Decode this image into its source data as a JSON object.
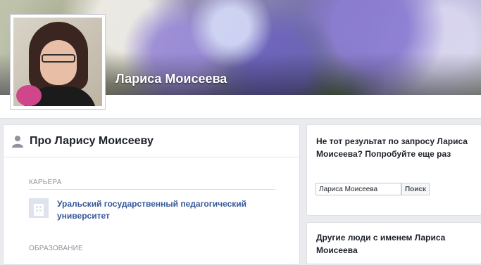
{
  "profile": {
    "name": "Лариса Моисеева"
  },
  "about": {
    "title": "Про Ларису Моисееву",
    "career_label": "КАРЬЕРА",
    "career_item": "Уральский государственный педагогический университет",
    "education_label": "ОБРАЗОВАНИЕ"
  },
  "search_box": {
    "prompt": "Не тот результат по запросу Лариса Моисеева? Попробуйте еще раз",
    "input_value": "Лариса Моисеева",
    "button_label": "Поиск"
  },
  "others": {
    "title": "Другие люди с именем Лариса Моисеева"
  },
  "colors": {
    "link": "#365899",
    "page_bg": "#e9ebee"
  },
  "icons": [
    "person-icon",
    "workplace-icon"
  ]
}
